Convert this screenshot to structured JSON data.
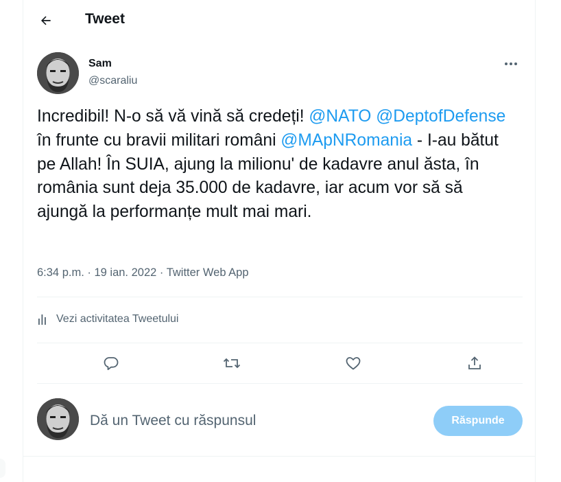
{
  "header": {
    "title": "Tweet",
    "back_icon": "arrow-left-icon"
  },
  "author": {
    "name": "Sam",
    "handle": "@scaraliu"
  },
  "tweet": {
    "segments": [
      {
        "text": "Incredibil! N-o să vă vină să credeți! ",
        "type": "text"
      },
      {
        "text": "@NATO",
        "type": "mention"
      },
      {
        "text": " ",
        "type": "text"
      },
      {
        "text": "@DeptofDefense",
        "type": "mention"
      },
      {
        "text": " în frunte cu bravii militari români ",
        "type": "text"
      },
      {
        "text": "@MApNRomania",
        "type": "mention"
      },
      {
        "text": " - I-au bătut pe Allah! În SUIA, ajung la milionu' de kadavre anul ăsta, în românia sunt deja 35.000 de kadavre, iar acum vor să să ajungă la performanțe mult mai mari.",
        "type": "text"
      }
    ],
    "time": "6:34 p.m.",
    "separator": " · ",
    "date": "19 ian. 2022",
    "source": "Twitter Web App"
  },
  "activity": {
    "label": "Vezi activitatea Tweetului",
    "icon": "analytics-bars-icon"
  },
  "actions": [
    {
      "name": "reply-icon"
    },
    {
      "name": "retweet-icon"
    },
    {
      "name": "like-icon"
    },
    {
      "name": "share-icon"
    }
  ],
  "reply": {
    "placeholder": "Dă un Tweet cu răspunsul",
    "button_label": "Răspunde"
  },
  "colors": {
    "accent": "#1d9bf0",
    "accent_disabled": "#8ecdf8",
    "secondary_text": "#536471",
    "primary_text": "#0f1419",
    "divider": "#eff3f4"
  }
}
